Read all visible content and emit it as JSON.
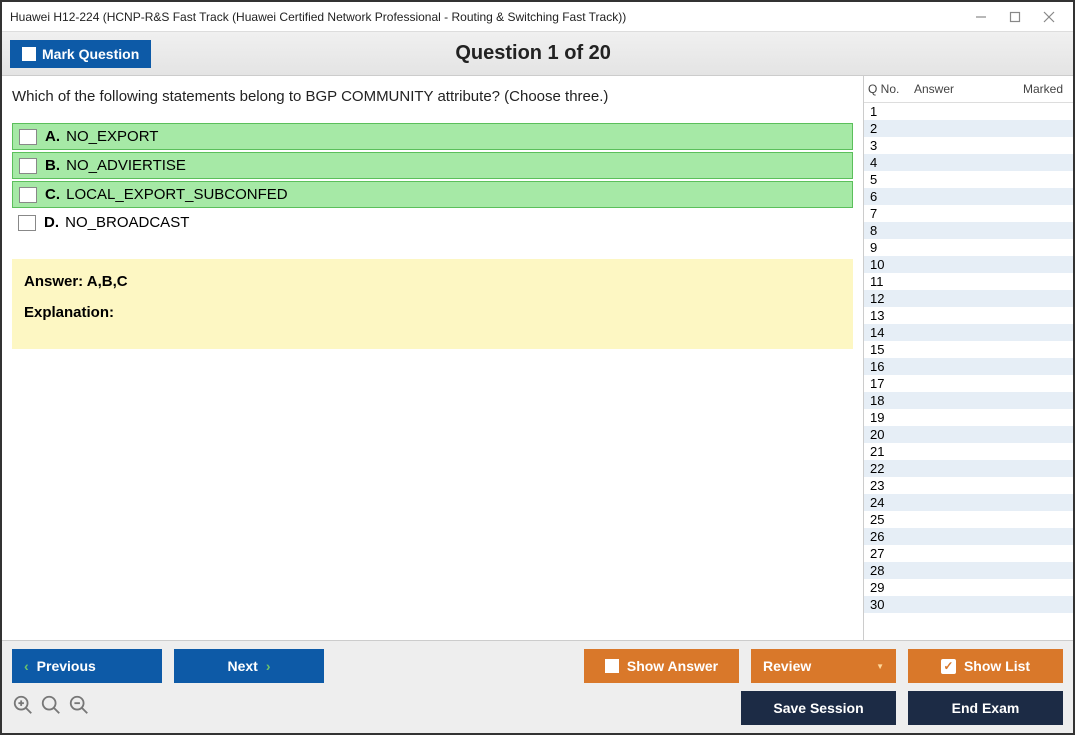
{
  "window": {
    "title": "Huawei H12-224 (HCNP-R&S Fast Track (Huawei Certified Network Professional - Routing & Switching Fast Track))"
  },
  "toolbar": {
    "mark_label": "Mark Question",
    "question_title": "Question 1 of 20"
  },
  "question": {
    "text": "Which of the following statements belong to BGP COMMUNITY attribute? (Choose three.)",
    "choices": [
      {
        "letter": "A.",
        "text": "NO_EXPORT",
        "correct": true
      },
      {
        "letter": "B.",
        "text": "NO_ADVIERTISE",
        "correct": true
      },
      {
        "letter": "C.",
        "text": "LOCAL_EXPORT_SUBCONFED",
        "correct": true
      },
      {
        "letter": "D.",
        "text": "NO_BROADCAST",
        "correct": false
      }
    ]
  },
  "answer_panel": {
    "answer": "Answer: A,B,C",
    "explanation_label": "Explanation:"
  },
  "sidebar": {
    "headers": {
      "qno": "Q No.",
      "answer": "Answer",
      "marked": "Marked"
    },
    "rows": [
      1,
      2,
      3,
      4,
      5,
      6,
      7,
      8,
      9,
      10,
      11,
      12,
      13,
      14,
      15,
      16,
      17,
      18,
      19,
      20,
      21,
      22,
      23,
      24,
      25,
      26,
      27,
      28,
      29,
      30
    ]
  },
  "footer": {
    "previous": "Previous",
    "next": "Next",
    "show_answer": "Show Answer",
    "review": "Review",
    "show_list": "Show List",
    "save_session": "Save Session",
    "end_exam": "End Exam"
  }
}
